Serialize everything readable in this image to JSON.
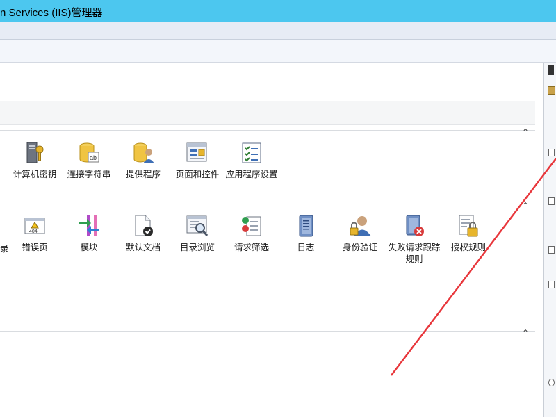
{
  "window": {
    "title": "n Services (IIS)管理器"
  },
  "section1": {
    "items": [
      {
        "label": "计算机密钥",
        "icon": "computer-key-icon"
      },
      {
        "label": "连接字符串",
        "icon": "connection-string-icon"
      },
      {
        "label": "提供程序",
        "icon": "providers-icon"
      },
      {
        "label": "页面和控件",
        "icon": "pages-controls-icon"
      },
      {
        "label": "应用程序设置",
        "icon": "app-settings-icon"
      }
    ]
  },
  "section2": {
    "edge_label": "录",
    "items": [
      {
        "label": "错误页",
        "icon": "error-page-icon"
      },
      {
        "label": "模块",
        "icon": "modules-icon"
      },
      {
        "label": "默认文档",
        "icon": "default-document-icon"
      },
      {
        "label": "目录浏览",
        "icon": "directory-browsing-icon"
      },
      {
        "label": "请求筛选",
        "icon": "request-filtering-icon"
      },
      {
        "label": "日志",
        "icon": "logging-icon"
      },
      {
        "label": "身份验证",
        "icon": "authentication-icon"
      },
      {
        "label": "失败请求跟踪规则",
        "icon": "failed-request-tracing-icon"
      },
      {
        "label": "授权规则",
        "icon": "authorization-rules-icon"
      }
    ]
  },
  "colors": {
    "titlebar": "#4cc7ef",
    "annotation_arrow": "#e8363b"
  }
}
